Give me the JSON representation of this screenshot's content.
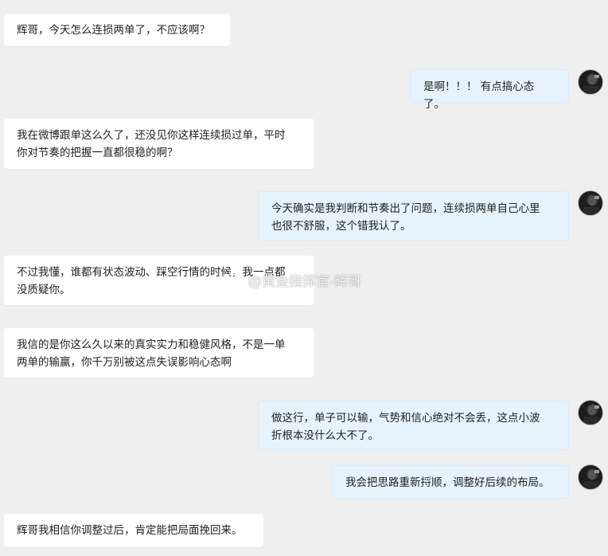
{
  "messages": [
    {
      "side": "left",
      "text": "辉哥，今天怎么连损两单了，不应该啊？"
    },
    {
      "side": "right",
      "text": "是啊！！！ 有点搞心态了。"
    },
    {
      "side": "left",
      "text": "我在微博跟单这么久了，还没见你这样连续损过单，平时\n你对节奏的把握一直都很稳的啊？"
    },
    {
      "side": "right",
      "text": "今天确实是我判断和节奏出了问题，连续损两单自己心里\n也很不舒服，这个错我认了。"
    },
    {
      "side": "left",
      "text": "不过我懂，谁都有状态波动、踩空行情的时候，我一点都\n没质疑你。"
    },
    {
      "side": "left",
      "text": "我信的是你这么久以来的真实实力和稳健风格，不是一单\n两单的输赢，你千万别被这点失误影响心态啊"
    },
    {
      "side": "right",
      "text": "做这行，单子可以输，气势和信心绝对不会丢，这点小波\n折根本没什么大不了。"
    },
    {
      "side": "right",
      "text": "我会把思路重新捋顺，调整好后续的布局。"
    },
    {
      "side": "left",
      "text": "辉哥我相信你调整过后，肯定能把局面挽回来。"
    }
  ],
  "watermark": {
    "text": "@黄金指挥官-辉哥",
    "icon": "weibo-icon"
  },
  "avatar_icon": "user-avatar-icon"
}
